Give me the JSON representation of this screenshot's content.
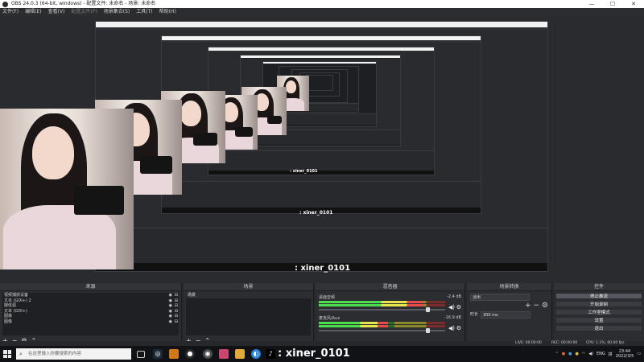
{
  "window": {
    "title": "OBS 24.0.3 (64-bit, windows) - 配置文件: 未命名 - 场景: 未命名"
  },
  "window_controls": [
    "—",
    "☐",
    "✕"
  ],
  "menu": [
    {
      "label": "文件(F)",
      "dim": false
    },
    {
      "label": "编辑(E)",
      "dim": false
    },
    {
      "label": "查看(V)",
      "dim": false
    },
    {
      "label": "配置文件(P)",
      "dim": true
    },
    {
      "label": "场景集合(S)",
      "dim": false
    },
    {
      "label": "工具(T)",
      "dim": false
    },
    {
      "label": "帮助(H)",
      "dim": false
    }
  ],
  "preview_overlay_handle": ": xiner_0101",
  "docks": {
    "sources": {
      "title": "来源",
      "items": [
        "视频捕获设备",
        "文本 (GDI+) 2",
        "媒体源",
        "文本 (GDI+)",
        "图像",
        "图像"
      ]
    },
    "scenes": {
      "title": "场景",
      "items": [
        "场景"
      ]
    },
    "mixer": {
      "title": "混音器",
      "channels": [
        {
          "name": "桌面音频",
          "db": "-2.4 dB",
          "level": 0.82,
          "volume": 0.86
        },
        {
          "name": "麦克风/Aux",
          "db": "-16.9 dB",
          "level": 0.55,
          "volume": 0.86
        }
      ]
    },
    "transitions": {
      "title": "场景转换",
      "selected": "淡出",
      "duration_label": "时长",
      "duration_value": "300 ms"
    },
    "controls": {
      "title": "控件",
      "buttons": [
        "停止推流",
        "开始录制",
        "工作室模式",
        "设置",
        "退出"
      ]
    }
  },
  "tools": {
    "add": "+",
    "remove": "−",
    "settings": "⚙",
    "up": "⌃",
    "down": "⌄"
  },
  "statusbar": {
    "live": "LIVE: 00:00:00",
    "rec": "REC: 00:00:00",
    "cpu": "CPU: 1.1%, 60.00 fps"
  },
  "taskbar": {
    "search_placeholder": "在这里输入你要搜索的内容",
    "handle": ": xiner_0101",
    "lang": "ENG",
    "time": "23:44",
    "date": "2022/3/5"
  }
}
